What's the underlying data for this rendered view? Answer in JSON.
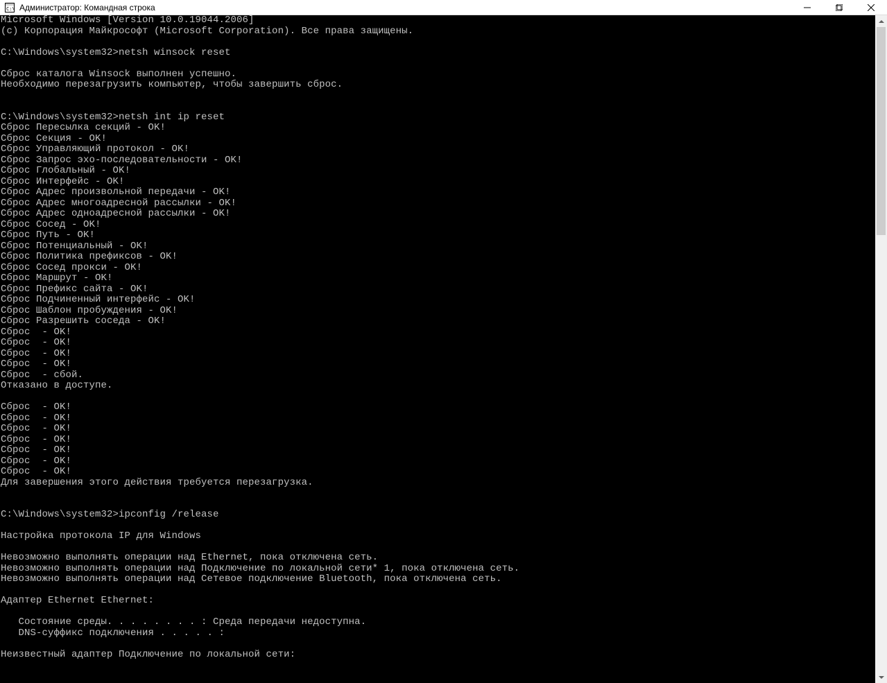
{
  "titlebar": {
    "title": "Администратор: Командная строка"
  },
  "console": {
    "lines": [
      "Microsoft Windows [Version 10.0.19044.2006]",
      "(c) Корпорация Майкрософт (Microsoft Corporation). Все права защищены.",
      "",
      "C:\\Windows\\system32>netsh winsock reset",
      "",
      "Сброс каталога Winsock выполнен успешно.",
      "Необходимо перезагрузить компьютер, чтобы завершить сброс.",
      "",
      "",
      "C:\\Windows\\system32>netsh int ip reset",
      "Сброс Пересылка секций - OK!",
      "Сброс Секция - OK!",
      "Сброс Управляющий протокол - OK!",
      "Сброс Запрос эхо-последовательности - OK!",
      "Сброс Глобальный - OK!",
      "Сброс Интерфейс - OK!",
      "Сброс Адрес произвольной передачи - OK!",
      "Сброс Адрес многоадресной рассылки - OK!",
      "Сброс Адрес одноадресной рассылки - OK!",
      "Сброс Сосед - OK!",
      "Сброс Путь - OK!",
      "Сброс Потенциальный - OK!",
      "Сброс Политика префиксов - OK!",
      "Сброс Сосед прокси - OK!",
      "Сброс Маршрут - OK!",
      "Сброс Префикс сайта - OK!",
      "Сброс Подчиненный интерфейс - OK!",
      "Сброс Шаблон пробуждения - OK!",
      "Сброс Разрешить соседа - OK!",
      "Сброс  - OK!",
      "Сброс  - OK!",
      "Сброс  - OK!",
      "Сброс  - OK!",
      "Сброс  - сбой.",
      "Отказано в доступе.",
      "",
      "Сброс  - OK!",
      "Сброс  - OK!",
      "Сброс  - OK!",
      "Сброс  - OK!",
      "Сброс  - OK!",
      "Сброс  - OK!",
      "Сброс  - OK!",
      "Для завершения этого действия требуется перезагрузка.",
      "",
      "",
      "C:\\Windows\\system32>ipconfig /release",
      "",
      "Настройка протокола IP для Windows",
      "",
      "Невозможно выполнять операции над Ethernet, пока отключена сеть.",
      "Невозможно выполнять операции над Подключение по локальной сети* 1, пока отключена сеть.",
      "Невозможно выполнять операции над Сетевое подключение Bluetooth, пока отключена сеть.",
      "",
      "Адаптер Ethernet Ethernet:",
      "",
      "   Состояние среды. . . . . . . . : Среда передачи недоступна.",
      "   DNS-суффикс подключения . . . . . :",
      "",
      "Неизвестный адаптер Подключение по локальной сети:"
    ]
  }
}
